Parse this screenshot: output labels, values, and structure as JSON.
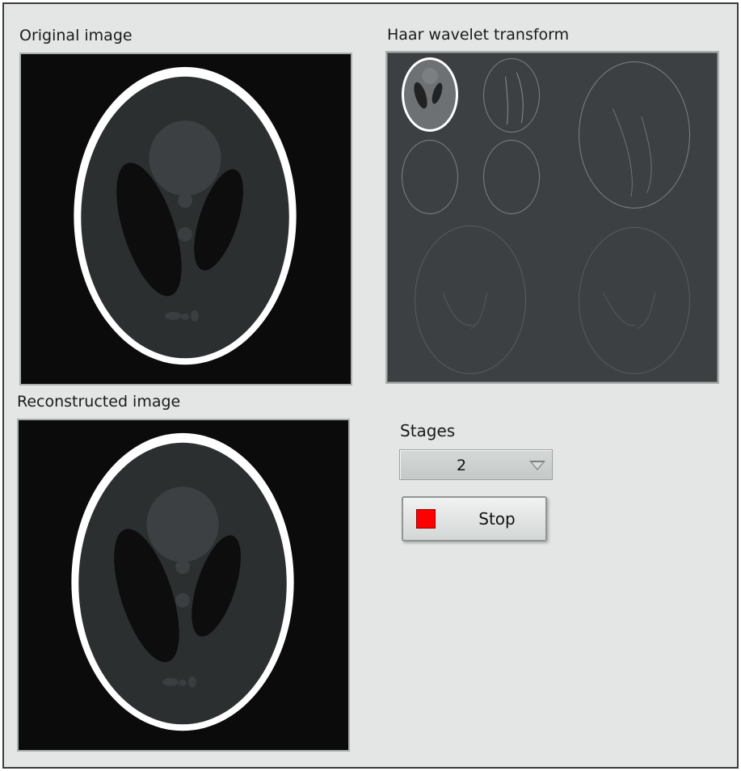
{
  "labels": {
    "original": "Original image",
    "wavelet": "Haar wavelet transform",
    "reconstructed": "Reconstructed image",
    "stages": "Stages"
  },
  "stages": {
    "selected": "2"
  },
  "stop": {
    "label": "Stop"
  },
  "colors": {
    "panel": "#e3e6e5",
    "image_bg": "#0b0b0b",
    "wavelet_bg": "#3d4042",
    "stop_led": "#ff0000"
  },
  "icons": {
    "dropdown": "triangle-down-icon",
    "stop_led": "red-square-icon"
  }
}
